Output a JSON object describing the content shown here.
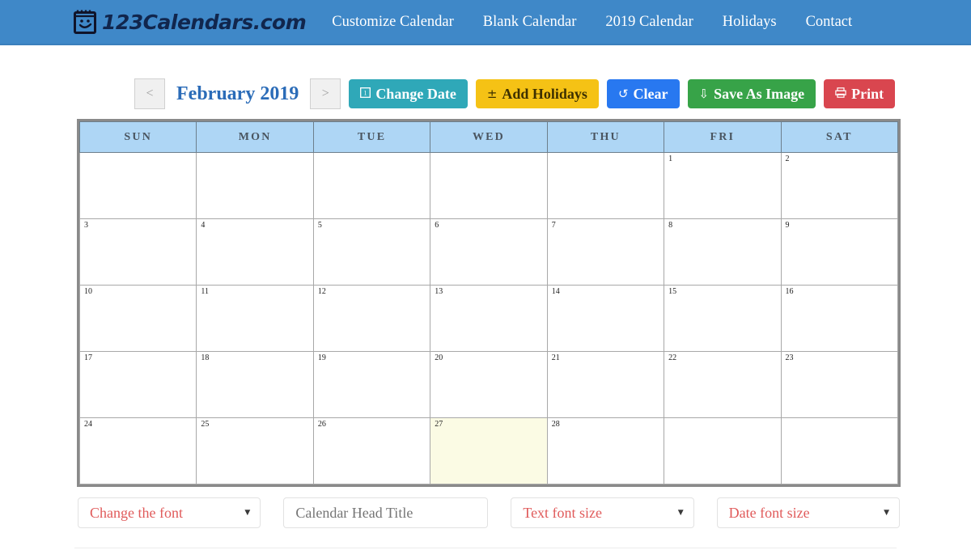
{
  "header": {
    "brand_name": "123Calendars.com",
    "brand_icon": "calendar-smiley-icon",
    "nav": [
      {
        "label": "Customize Calendar"
      },
      {
        "label": "Blank Calendar"
      },
      {
        "label": "2019 Calendar"
      },
      {
        "label": "Holidays"
      },
      {
        "label": "Contact"
      }
    ]
  },
  "toolbar": {
    "prev_label": "<",
    "next_label": ">",
    "month_label": "February 2019",
    "change_date": {
      "label": "Change Date",
      "glyph": "⛶",
      "color": "#2fa8b8"
    },
    "add_holidays": {
      "label": "Add Holidays",
      "glyph": "±",
      "color": "#f5c215"
    },
    "clear": {
      "label": "Clear",
      "glyph": "↺",
      "color": "#2878f0"
    },
    "save_image": {
      "label": "Save As Image",
      "glyph": "⇩",
      "color": "#37a348"
    },
    "print": {
      "label": "Print",
      "glyph": "⎙",
      "color": "#d9464f"
    }
  },
  "calendar": {
    "weekday_headers": [
      "SUN",
      "MON",
      "TUE",
      "WED",
      "THU",
      "FRI",
      "SAT"
    ],
    "header_bg": "#aed6f5",
    "highlight_bg": "#fbfbe4",
    "weeks": [
      [
        "",
        "",
        "",
        "",
        "",
        "1",
        "2"
      ],
      [
        "3",
        "4",
        "5",
        "6",
        "7",
        "8",
        "9"
      ],
      [
        "10",
        "11",
        "12",
        "13",
        "14",
        "15",
        "16"
      ],
      [
        "17",
        "18",
        "19",
        "20",
        "21",
        "22",
        "23"
      ],
      [
        "24",
        "25",
        "26",
        "27",
        "28",
        "",
        ""
      ]
    ],
    "highlighted_day": "27"
  },
  "controls": {
    "font_select": "Change the font",
    "head_title_placeholder": "Calendar Head Title",
    "head_title_value": "",
    "text_font_size": "Text font size",
    "date_font_size": "Date font size"
  }
}
